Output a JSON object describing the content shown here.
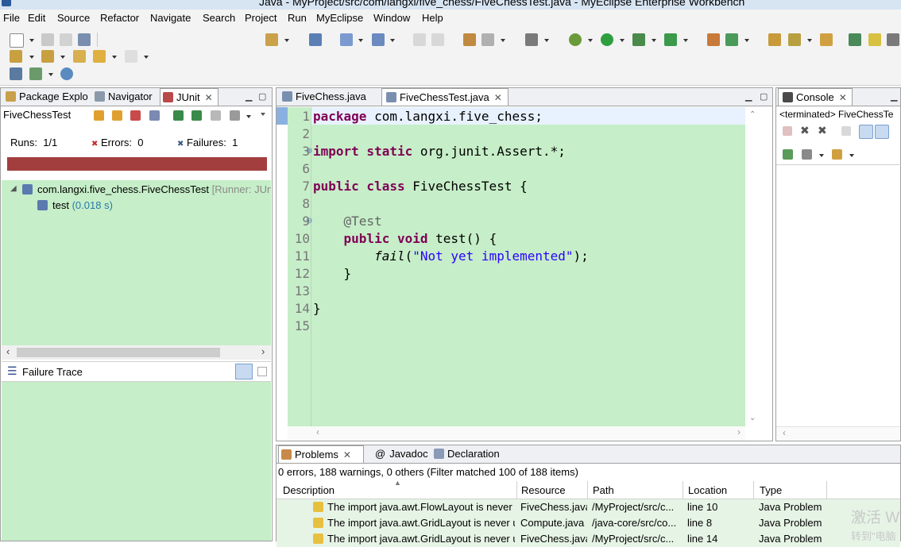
{
  "window": {
    "title": "Java - MyProject/src/com/langxi/five_chess/FiveChessTest.java - MyEclipse Enterprise Workbench"
  },
  "menu": [
    "File",
    "Edit",
    "Source",
    "Refactor",
    "Navigate",
    "Search",
    "Project",
    "Run",
    "MyEclipse",
    "Window",
    "Help"
  ],
  "left_pane": {
    "tabs": [
      "Package Explo",
      "Navigator",
      "JUnit"
    ],
    "junit": {
      "suite_name": "FiveChessTest",
      "runs_label": "Runs:",
      "runs_value": "1/1",
      "errors_label": "Errors:",
      "errors_value": "0",
      "failures_label": "Failures:",
      "failures_value": "1",
      "bar_color": "#a23e3e",
      "tree_class": "com.langxi.five_chess.FiveChessTest",
      "tree_runner": "[Runner: JUnit",
      "tree_test": "test",
      "tree_test_time": "(0.018 s)",
      "failure_trace_label": "Failure Trace"
    }
  },
  "editor": {
    "tabs": [
      "FiveChess.java",
      "FiveChessTest.java"
    ],
    "lines": [
      {
        "num": "1",
        "parts": [
          {
            "t": "package",
            "c": "kw"
          },
          {
            "t": " com.langxi.five_chess;",
            "c": ""
          }
        ]
      },
      {
        "num": "2",
        "parts": []
      },
      {
        "num": "3",
        "parts": [
          {
            "t": "import static",
            "c": "kw"
          },
          {
            "t": " org.junit.Assert.*;",
            "c": ""
          }
        ]
      },
      {
        "num": "6",
        "parts": []
      },
      {
        "num": "7",
        "parts": [
          {
            "t": "public class",
            "c": "kw"
          },
          {
            "t": " FiveChessTest {",
            "c": ""
          }
        ]
      },
      {
        "num": "8",
        "parts": []
      },
      {
        "num": "9",
        "parts": [
          {
            "t": "    @Test",
            "c": "ann"
          }
        ]
      },
      {
        "num": "10",
        "parts": [
          {
            "t": "    ",
            "c": ""
          },
          {
            "t": "public void",
            "c": "kw"
          },
          {
            "t": " test() {",
            "c": ""
          }
        ]
      },
      {
        "num": "11",
        "parts": [
          {
            "t": "        ",
            "c": ""
          },
          {
            "t": "fail",
            "c": "it"
          },
          {
            "t": "(",
            "c": ""
          },
          {
            "t": "\"Not yet implemented\"",
            "c": "str"
          },
          {
            "t": ");",
            "c": ""
          }
        ]
      },
      {
        "num": "12",
        "parts": [
          {
            "t": "    }",
            "c": ""
          }
        ]
      },
      {
        "num": "13",
        "parts": []
      },
      {
        "num": "14",
        "parts": [
          {
            "t": "}",
            "c": ""
          }
        ]
      },
      {
        "num": "15",
        "parts": []
      }
    ]
  },
  "console": {
    "tab": "Console",
    "status": "<terminated> FiveChessTe"
  },
  "problems": {
    "tabs": [
      "Problems",
      "Javadoc",
      "Declaration"
    ],
    "summary": "0 errors, 188 warnings, 0 others (Filter matched 100 of 188 items)",
    "columns": [
      "Description",
      "Resource",
      "Path",
      "Location",
      "Type"
    ],
    "rows": [
      {
        "description": "The import java.awt.FlowLayout is never u",
        "resource": "FiveChess.java",
        "path": "/MyProject/src/c...",
        "location": "line 10",
        "type": "Java Problem"
      },
      {
        "description": "The import java.awt.GridLayout is never u",
        "resource": "Compute.java",
        "path": "/java-core/src/co...",
        "location": "line 8",
        "type": "Java Problem"
      },
      {
        "description": "The import java.awt.GridLayout is never u",
        "resource": "FiveChess.java",
        "path": "/MyProject/src/c...",
        "location": "line 14",
        "type": "Java Problem"
      }
    ]
  },
  "watermark": {
    "line1": "激活 W",
    "line2": "转到\"电脑"
  }
}
